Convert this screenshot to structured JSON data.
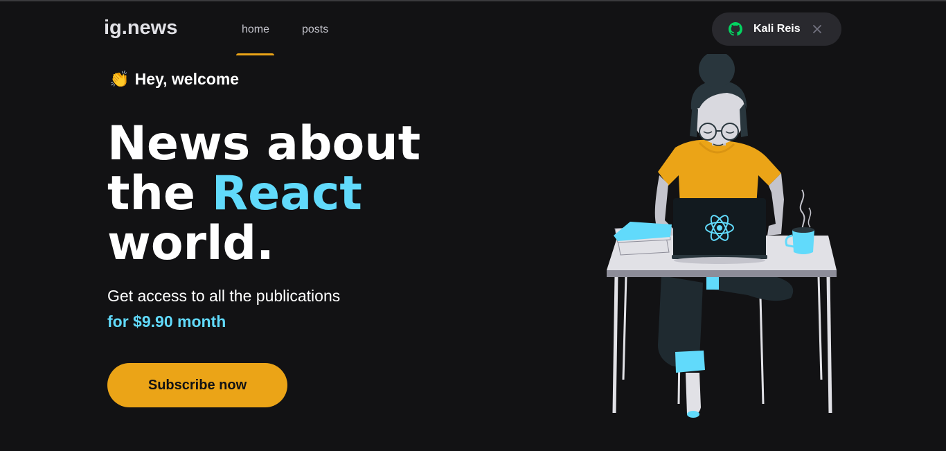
{
  "header": {
    "logo": "ig.news",
    "nav": [
      {
        "label": "home",
        "active": true
      },
      {
        "label": "posts",
        "active": false
      }
    ],
    "signin": {
      "user_name": "Kali Reis",
      "icon": "github-icon",
      "close_icon": "close-icon"
    }
  },
  "hero": {
    "welcome_emoji": "👏",
    "welcome_text": "Hey, welcome",
    "headline_line1": "News about",
    "headline_line2_prefix": "the ",
    "headline_highlight": "React",
    "headline_line3": "world.",
    "subtitle": "Get access to all the publications",
    "price": "for $9.90 month",
    "cta_label": "Subscribe now"
  },
  "colors": {
    "background": "#121214",
    "accent_yellow": "#eba417",
    "accent_cyan": "#61dafb",
    "pill": "#29292e",
    "github_green": "#04d361"
  }
}
